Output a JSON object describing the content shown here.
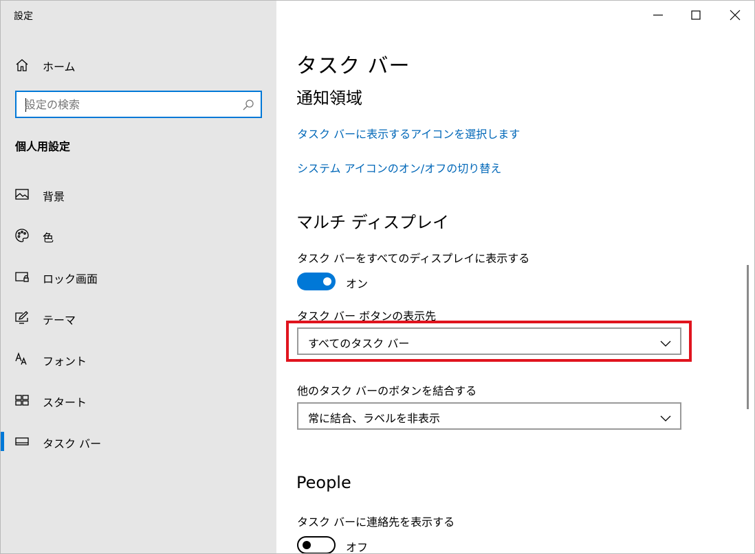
{
  "window": {
    "title": "設定",
    "minimize_icon": "minimize-icon",
    "maximize_icon": "maximize-icon",
    "close_icon": "close-icon"
  },
  "sidebar": {
    "home": {
      "label": "ホーム",
      "icon": "home-icon"
    },
    "search": {
      "placeholder": "設定の検索",
      "value": "",
      "icon": "search-icon"
    },
    "section_title": "個人用設定",
    "items": [
      {
        "label": "背景",
        "icon": "picture-icon",
        "active": false
      },
      {
        "label": "色",
        "icon": "palette-icon",
        "active": false
      },
      {
        "label": "ロック画面",
        "icon": "lock-screen-icon",
        "active": false
      },
      {
        "label": "テーマ",
        "icon": "theme-icon",
        "active": false
      },
      {
        "label": "フォント",
        "icon": "font-icon",
        "active": false
      },
      {
        "label": "スタート",
        "icon": "start-icon",
        "active": false
      },
      {
        "label": "タスク バー",
        "icon": "taskbar-icon",
        "active": true
      }
    ],
    "accent_color": "#0078d7"
  },
  "main": {
    "page_title": "タスク バー",
    "notification_area": {
      "heading": "通知領域",
      "links": [
        "タスク バーに表示するアイコンを選択します",
        "システム アイコンのオン/オフの切り替え"
      ]
    },
    "multi_display": {
      "heading": "マルチ ディスプレイ",
      "show_all_label": "タスク バーをすべてのディスプレイに表示する",
      "show_all_state": "オン",
      "buttons_on_label": "タスク バー ボタンの表示先",
      "buttons_on_value": "すべてのタスク バー",
      "combine_label": "他のタスク バーのボタンを結合する",
      "combine_value": "常に結合、ラベルを非表示"
    },
    "people": {
      "heading": "People",
      "show_contacts_label": "タスク バーに連絡先を表示する",
      "show_contacts_state": "オフ"
    },
    "link_color": "#0067b8",
    "highlight_color": "#e0141e"
  }
}
